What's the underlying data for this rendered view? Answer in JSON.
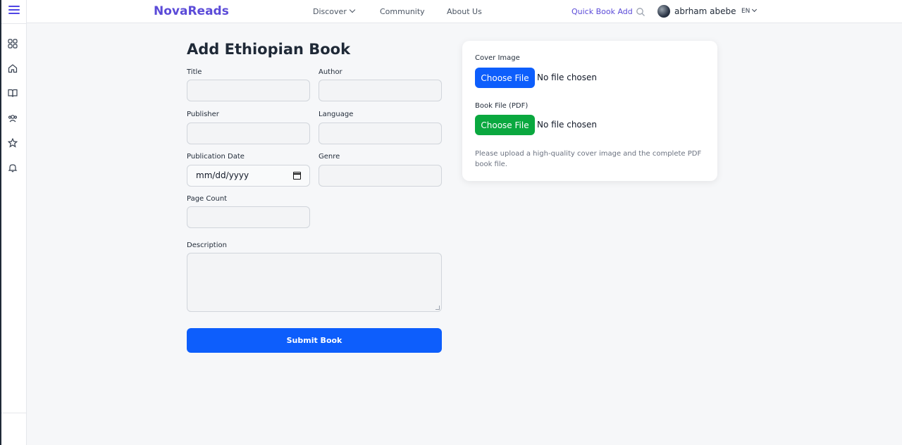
{
  "header": {
    "logo": "NovaReads",
    "nav": {
      "discover": "Discover",
      "community": "Community",
      "about": "About Us"
    },
    "quick_add": "Quick Book Add",
    "user_name": "abrham abebe",
    "language": "EN"
  },
  "sidebar": {
    "icons": [
      "grid-icon",
      "home-icon",
      "book-icon",
      "users-icon",
      "star-icon",
      "bell-icon"
    ]
  },
  "form": {
    "title": "Add Ethiopian Book",
    "labels": {
      "title": "Title",
      "author": "Author",
      "publisher": "Publisher",
      "language": "Language",
      "publication_date": "Publication Date",
      "genre": "Genre",
      "page_count": "Page Count",
      "description": "Description"
    },
    "date_placeholder": "mm/dd/yyyy",
    "submit": "Submit Book"
  },
  "upload": {
    "cover_label": "Cover Image",
    "cover_button": "Choose File",
    "cover_status": "No file chosen",
    "pdf_label": "Book File (PDF)",
    "pdf_button": "Choose File",
    "pdf_status": "No file chosen",
    "hint": "Please upload a high-quality cover image and the complete PDF book file."
  },
  "colors": {
    "brand": "#5b4bd8",
    "primary_button": "#0d5efc",
    "cover_button": "#0d5efc",
    "pdf_button": "#0aa83f"
  }
}
